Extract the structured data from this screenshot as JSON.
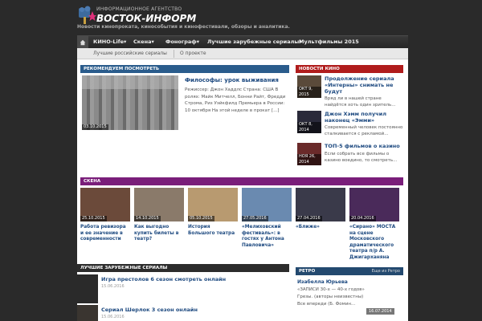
{
  "header": {
    "logo_top": "ИНФОРМАЦИОННОЕ АГЕНТСТВО",
    "logo_main": "ВОСТОК-ИНФОРМ",
    "logo_icon": "film-star-logo",
    "tagline": "Новости кинопроката, кинособытия и кинофестивали, обзоры и аналитика."
  },
  "nav": {
    "home_icon": "home-icon",
    "items": [
      {
        "label": "КИНО-Life▾"
      },
      {
        "label": "Скена▾"
      },
      {
        "label": "Фонограф▾"
      },
      {
        "label": "Лучшие зарубежные сериалы▾"
      },
      {
        "label": "Мультфильмы 2015"
      }
    ],
    "sub_items": [
      {
        "label": "Лучшие российские сериалы"
      },
      {
        "label": "О проекте"
      }
    ]
  },
  "featured": {
    "heading": "РЕКОМЕНДУЕМ ПОСМОТРЕТЬ",
    "date": "03.10.2015",
    "title": "Философы: урок выживания",
    "text": "Режиссер: Джон Хаддлс Страна: США В ролях: Майк Митчелл, Бонни Райт, Фредди Строма, Риз Уэйкфилд Премьера в России: 10 октября На этой неделе в прокат [...]"
  },
  "news": {
    "heading": "НОВОСТИ КИНО",
    "items": [
      {
        "date": "ОКТ 9, 2015",
        "title": "Продолжение сериала «Интерны» снимать не будут",
        "text": "Вряд ли в нашей стране найдётся хоть один зритель..."
      },
      {
        "date": "ОКТ 8, 2014",
        "title": "Джон Хэмм получил наконец «Эмми»",
        "text": "Современный человек постоянно сталкивается с рекламой..."
      },
      {
        "date": "НОЯ 26, 2014",
        "title": "ТОП-5 фильмов о казино",
        "text": "Если собрать все фильмы о казино воедино, то смотреть..."
      }
    ]
  },
  "scene": {
    "heading": "СКЕНА",
    "items": [
      {
        "date": "25.10.2015",
        "title": "Работа ревизора и ее значение в современности",
        "color": "#6b4a3a"
      },
      {
        "date": "14.10.2015",
        "title": "Как выгодно купить билеты в театр?",
        "color": "#8a7a6a"
      },
      {
        "date": "05.10.2015",
        "title": "История Большого театра",
        "color": "#b89a70"
      },
      {
        "date": "27.05.2016",
        "title": "«Мелиховский фестиваль»: в гостях у Антона Павловича»",
        "color": "#6a8ab0"
      },
      {
        "date": "27.04.2016",
        "title": "«Ближе»",
        "color": "#3a3a4a"
      },
      {
        "date": "20.04.2016",
        "title": "«Сирано» МОСТА на сцене Московского драматического театра п/р А. Джигарханяна",
        "color": "#4a2a5a"
      }
    ]
  },
  "series": {
    "heading": "ЛУЧШИЕ ЗАРУБЕЖНЫЕ СЕРИАЛЫ",
    "items": [
      {
        "title": "Игра престолов 6 сезон смотреть онлайн",
        "date": "15.06.2016"
      },
      {
        "title": "Сериал Шерлок 3 сезон онлайн",
        "date": "15.06.2016"
      }
    ]
  },
  "retro": {
    "heading": "РЕТРО",
    "more": "Еще из Ретро",
    "author": "Изабелла Юрьева",
    "lines": [
      "«ЗАПИСИ 30-х — 40-х годов»",
      "Грезы. (авторы неизвестны)",
      "Все впереди (Б. Фомин..."
    ],
    "date": "16.07.2014"
  },
  "colors": {
    "blue_heading": "#2a5c8c",
    "red_heading": "#b01c1c",
    "purple_heading": "#7a1e7a",
    "link": "#1e4a80"
  }
}
